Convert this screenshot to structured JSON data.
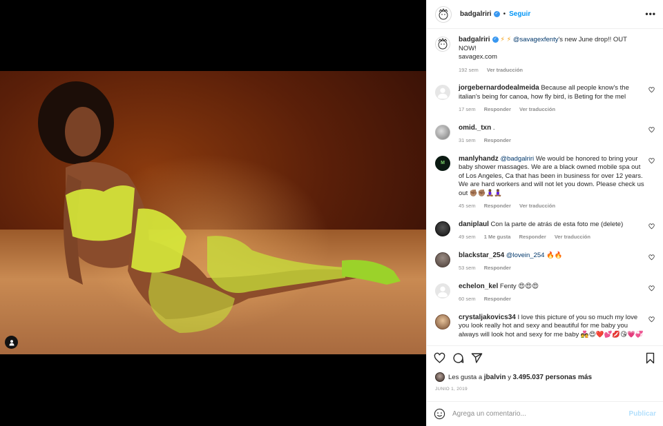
{
  "header": {
    "username": "badgalriri",
    "dot": "•",
    "follow_label": "Seguir",
    "more_label": "•••"
  },
  "caption": {
    "username": "badgalriri",
    "emojis": "⚡ ⚡",
    "mention": "@savagexfenty",
    "text": "'s new June drop!! OUT NOW!",
    "link": "savagex.com",
    "time": "192 sem",
    "translate": "Ver traducción"
  },
  "comments": [
    {
      "user": "jorgebernardodealmeida",
      "mention": "",
      "text": "Because all people know's the italian's being for canoa, how fly bird, is Beting for the mel",
      "time": "17 sem",
      "likes": "",
      "reply": "Responder",
      "translate": "Ver traducción"
    },
    {
      "user": "omid._txn",
      "mention": "",
      "text": ".",
      "time": "31 sem",
      "likes": "",
      "reply": "Responder",
      "translate": ""
    },
    {
      "user": "manlyhandz",
      "mention": "@badgalriri",
      "text": "We would be honored to bring your baby shower massages. We are a black owned mobile spa out of Los Angeles, Ca that has been in business for over 12 years. We are hard workers and will not let you down. Please check us out ✊🏽✊🏽🧘🏾‍♀️🧘🏾‍♀️",
      "time": "45 sem",
      "likes": "",
      "reply": "Responder",
      "translate": "Ver traducción"
    },
    {
      "user": "daniplaul",
      "mention": "",
      "text": "Con la parte de atrás de esta foto me (delete)",
      "time": "49 sem",
      "likes": "1 Me gusta",
      "reply": "Responder",
      "translate": "Ver traducción"
    },
    {
      "user": "blackstar_254",
      "mention": "@lovein_254",
      "text": "🔥🔥",
      "time": "53 sem",
      "likes": "",
      "reply": "Responder",
      "translate": ""
    },
    {
      "user": "echelon_kel",
      "mention": "",
      "text": "Fenty 😍😍😍",
      "time": "60 sem",
      "likes": "",
      "reply": "Responder",
      "translate": ""
    },
    {
      "user": "crystaljakovics34",
      "mention": "",
      "text": "I love this picture of you so much my love you look really hot and sexy and beautiful for me baby you always will look hot and sexy for me baby 💑😍❤️💕💋😘💗💞",
      "time": "",
      "likes": "",
      "reply": "",
      "translate": ""
    }
  ],
  "likes": {
    "prefix": "Les gusta a",
    "user": "jbalvin",
    "middle": "y",
    "count": "3.495.037 personas más"
  },
  "date": "JUNIO 1, 2019",
  "add_comment": {
    "placeholder": "Agrega un comentario...",
    "publish": "Publicar"
  },
  "icons": [
    "user-tag-icon",
    "heart-icon",
    "comment-icon",
    "share-icon",
    "bookmark-icon",
    "emoji-icon",
    "verified-icon",
    "more-icon"
  ],
  "colors": {
    "accent": "#0095f6",
    "verified": "#3897f0",
    "lingerie": "#d6ea3a"
  }
}
